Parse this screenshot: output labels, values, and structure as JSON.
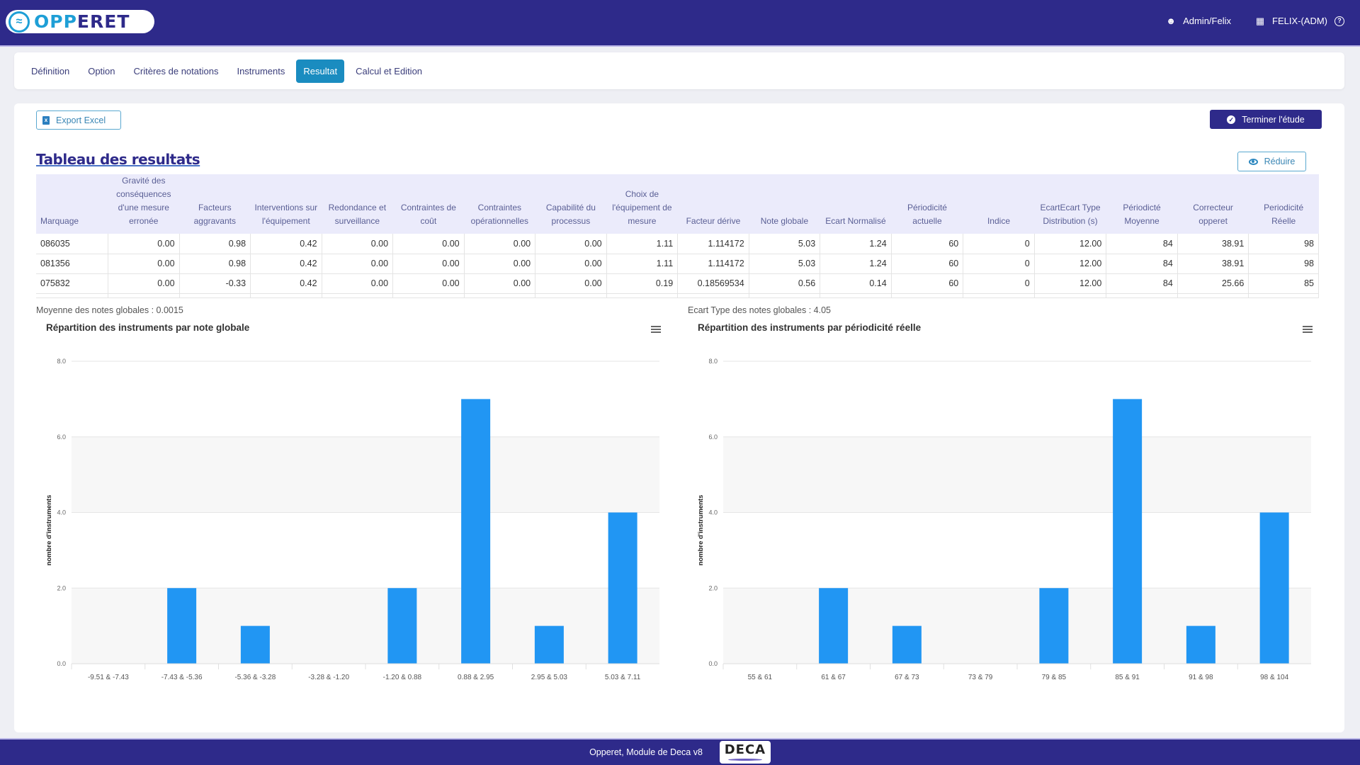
{
  "header": {
    "logo_text_a": "OPP",
    "logo_text_b": "E",
    "logo_text_c": "RET",
    "user": "Admin/Felix",
    "company": "FELIX-(ADM)",
    "user_icon": "user-icon",
    "company_icon": "building-icon",
    "help_icon": "help-icon"
  },
  "tabs": [
    {
      "label": "Définition",
      "active": false
    },
    {
      "label": "Option",
      "active": false
    },
    {
      "label": "Critères de notations",
      "active": false
    },
    {
      "label": "Instruments",
      "active": false
    },
    {
      "label": "Resultat",
      "active": true
    },
    {
      "label": "Calcul et Edition",
      "active": false
    }
  ],
  "toolbar": {
    "export_label": "Export Excel",
    "terminer_label": "Terminer l'étude",
    "reduire_label": "Réduire"
  },
  "section_title": "Tableau des resultats",
  "table": {
    "columns": [
      "Marquage",
      "Gravité des conséquences d'une mesure erronée",
      "Facteurs aggravants",
      "Interventions sur l'équipement",
      "Redondance et surveillance",
      "Contraintes de coût",
      "Contraintes opérationnelles",
      "Capabilité du processus",
      "Choix de l'équipement de mesure",
      "Facteur dérive",
      "Note globale",
      "Ecart Normalisé",
      "Périodicité actuelle",
      "Indice",
      "EcartEcart Type Distribution (s)",
      "Périodicté Moyenne",
      "Correcteur opperet",
      "Periodicité Réelle"
    ],
    "rows": [
      [
        "086035",
        "0.00",
        "0.98",
        "0.42",
        "0.00",
        "0.00",
        "0.00",
        "0.00",
        "1.11",
        "1.114172",
        "5.03",
        "1.24",
        "60",
        "0",
        "12.00",
        "84",
        "38.91",
        "98"
      ],
      [
        "081356",
        "0.00",
        "0.98",
        "0.42",
        "0.00",
        "0.00",
        "0.00",
        "0.00",
        "1.11",
        "1.114172",
        "5.03",
        "1.24",
        "60",
        "0",
        "12.00",
        "84",
        "38.91",
        "98"
      ],
      [
        "075832",
        "0.00",
        "-0.33",
        "0.42",
        "0.00",
        "0.00",
        "0.00",
        "0.00",
        "0.19",
        "0.18569534",
        "0.56",
        "0.14",
        "60",
        "0",
        "12.00",
        "84",
        "25.66",
        "85"
      ]
    ]
  },
  "stats": {
    "moyenne": "Moyenne des notes globales : 0.0015",
    "ecart_type": "Ecart Type des notes globales : 4.05"
  },
  "footer": {
    "text": "Opperet, Module de Deca v8",
    "logo": "DECA"
  },
  "chart_data": [
    {
      "type": "bar",
      "title": "Répartition des instruments par note globale",
      "xlabel": "",
      "ylabel": "nombre d'instruments",
      "categories": [
        "-9.51 & -7.43",
        "-7.43 & -5.36",
        "-5.36 & -3.28",
        "-3.28 & -1.20",
        "-1.20 & 0.88",
        "0.88 & 2.95",
        "2.95 & 5.03",
        "5.03 & 7.11"
      ],
      "values": [
        0,
        2,
        1,
        0,
        2,
        7,
        1,
        4
      ],
      "ylim": [
        0,
        8
      ],
      "yticks": [
        "0.0",
        "2.0",
        "4.0",
        "6.0",
        "8.0"
      ],
      "color": "#2196f3",
      "grid": true,
      "legend": "none"
    },
    {
      "type": "bar",
      "title": "Répartition des instruments par périodicité réelle",
      "xlabel": "",
      "ylabel": "nombre d'instruments",
      "categories": [
        "55 & 61",
        "61 & 67",
        "67  & 73",
        "73 & 79",
        "79 & 85",
        "85  & 91",
        "91  & 98",
        "98 & 104"
      ],
      "values": [
        0,
        2,
        1,
        0,
        2,
        7,
        1,
        4
      ],
      "ylim": [
        0,
        8
      ],
      "yticks": [
        "0.0",
        "2.0",
        "4.0",
        "6.0",
        "8.0"
      ],
      "color": "#2196f3",
      "grid": true,
      "legend": "none"
    }
  ]
}
